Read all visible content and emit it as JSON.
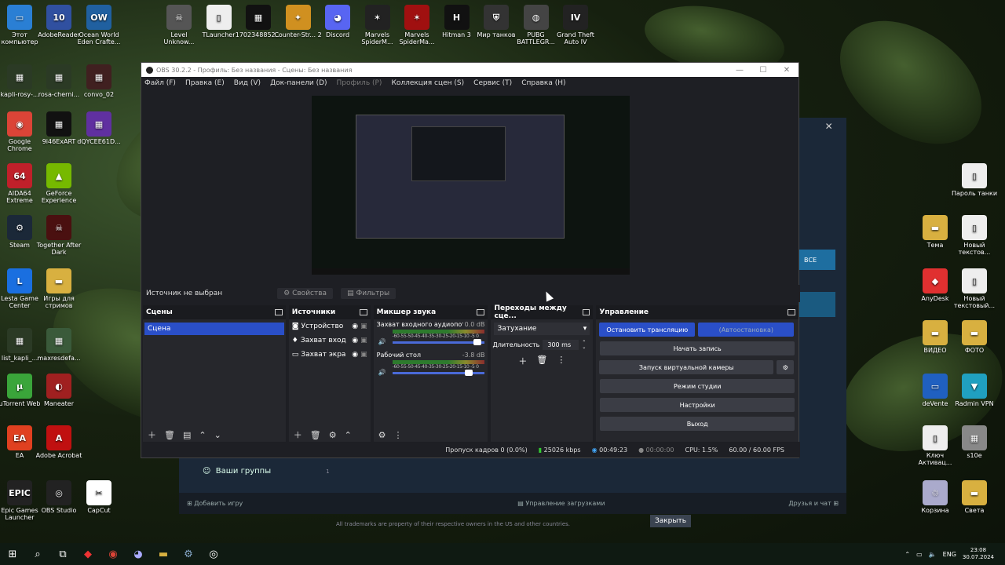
{
  "desktop": {
    "left_icons": [
      {
        "label": "Этот компьютер",
        "color": "#2a7fd4",
        "glyph": "▭"
      },
      {
        "label": "kapli-rosy-...",
        "color": "#2b3a25",
        "glyph": "▦"
      },
      {
        "label": "Google Chrome",
        "color": "#db4437",
        "glyph": "◉"
      },
      {
        "label": "AIDA64 Extreme",
        "color": "#c0202a",
        "glyph": "64"
      },
      {
        "label": "Steam",
        "color": "#1b2838",
        "glyph": "⚙"
      },
      {
        "label": "Lesta Game Center",
        "color": "#1a6fe0",
        "glyph": "L"
      },
      {
        "label": "list_kapli_...",
        "color": "#2b3a25",
        "glyph": "▦"
      },
      {
        "label": "uTorrent Web",
        "color": "#3aa53a",
        "glyph": "µ"
      },
      {
        "label": "EA",
        "color": "#e04020",
        "glyph": "EA"
      },
      {
        "label": "Epic Games Launcher",
        "color": "#222",
        "glyph": "EPIC"
      }
    ],
    "col2_icons": [
      {
        "label": "AdobeReader",
        "color": "#3050a0",
        "glyph": "10"
      },
      {
        "label": "rosa-cherni...",
        "color": "#2b3a25",
        "glyph": "▦"
      },
      {
        "label": "9i46ExART",
        "color": "#111",
        "glyph": "▦"
      },
      {
        "label": "GeForce Experience",
        "color": "#76b900",
        "glyph": "▲"
      },
      {
        "label": "Together After Dark",
        "color": "#4a1010",
        "glyph": "☠"
      },
      {
        "label": "Игры для стримов",
        "color": "#d8b040",
        "glyph": "▬"
      },
      {
        "label": "maxresdefa...",
        "color": "#3a5a3a",
        "glyph": "▦"
      },
      {
        "label": "Maneater",
        "color": "#a02020",
        "glyph": "◐"
      },
      {
        "label": "Adobe Acrobat",
        "color": "#c01010",
        "glyph": "A"
      },
      {
        "label": "OBS Studio",
        "color": "#222",
        "glyph": "◎"
      }
    ],
    "col3_icons": [
      {
        "label": "Ocean World Eden Crafte...",
        "color": "#2060a0",
        "glyph": "OW"
      },
      {
        "label": "convo_02",
        "color": "#402020",
        "glyph": "▦"
      },
      {
        "label": "dQYCEE61D...",
        "color": "#6030a0",
        "glyph": "▦"
      },
      {
        "label": "CapCut",
        "color": "#fff",
        "glyph": "✂"
      }
    ],
    "top_icons": [
      {
        "label": "Level Unknow...",
        "color": "#555",
        "glyph": "☠"
      },
      {
        "label": "TLauncher",
        "color": "#eee",
        "glyph": "▯"
      },
      {
        "label": "1702348852...",
        "color": "#111",
        "glyph": "▦"
      },
      {
        "label": "Counter-Str... 2",
        "color": "#d09020",
        "glyph": "✦"
      },
      {
        "label": "Discord",
        "color": "#5865f2",
        "glyph": "◕"
      },
      {
        "label": "Marvels SpiderM...",
        "color": "#222",
        "glyph": "✶"
      },
      {
        "label": "Marvels SpiderMa...",
        "color": "#a01010",
        "glyph": "✶"
      },
      {
        "label": "Hitman 3",
        "color": "#111",
        "glyph": "H"
      },
      {
        "label": "Мир танков",
        "color": "#333",
        "glyph": "⛨"
      },
      {
        "label": "PUBG BATTLEGR...",
        "color": "#444",
        "glyph": "◍"
      },
      {
        "label": "Grand Theft Auto IV",
        "color": "#222",
        "glyph": "IV"
      }
    ],
    "right_icons": [
      {
        "label": "Пароль танки",
        "color": "#eee",
        "glyph": "▯"
      },
      {
        "label": "Тема",
        "color": "#d8b040",
        "glyph": "▬"
      },
      {
        "label": "Новый текстов...",
        "color": "#eee",
        "glyph": "▯"
      },
      {
        "label": "AnyDesk",
        "color": "#e03030",
        "glyph": "◆"
      },
      {
        "label": "Новый текстовый...",
        "color": "#eee",
        "glyph": "▯"
      },
      {
        "label": "ВИДЕО",
        "color": "#d8b040",
        "glyph": "▬"
      },
      {
        "label": "ФОТО",
        "color": "#d8b040",
        "glyph": "▬"
      },
      {
        "label": "deVente",
        "color": "#2060c0",
        "glyph": "▭"
      },
      {
        "label": "Radmin VPN",
        "color": "#20a0c0",
        "glyph": "▼"
      },
      {
        "label": "Ключ Активац...",
        "color": "#eee",
        "glyph": "▯"
      },
      {
        "label": "s10e",
        "color": "#888",
        "glyph": "▦"
      },
      {
        "label": "Корзина",
        "color": "#aac",
        "glyph": "♲"
      },
      {
        "label": "Света",
        "color": "#d8b040",
        "glyph": "▬"
      }
    ]
  },
  "steam": {
    "btn_all": "ВСЕ",
    "groups_label": "Ваши группы",
    "add_game": "Добавить игру",
    "downloads": "Управление загрузками",
    "friends": "Друзья и чат",
    "legal": "All trademarks are property of their respective owners in the US and other countries.",
    "close": "Закрыть",
    "count": "1"
  },
  "obs": {
    "title": "OBS 30.2.2 - Профиль: Без названия - Сцены: Без названия",
    "menu": [
      "Файл (F)",
      "Правка (E)",
      "Вид (V)",
      "Док-панели (D)",
      "Профиль (P)",
      "Коллекция сцен (S)",
      "Сервис (T)",
      "Справка (H)"
    ],
    "source_bar": {
      "no_source": "Источник не выбран",
      "properties": "Свойства",
      "filters": "Фильтры"
    },
    "scenes": {
      "title": "Сцены",
      "items": [
        "Сцена"
      ]
    },
    "sources": {
      "title": "Источники",
      "items": [
        "Устройство",
        "Захват вход",
        "Захват экра"
      ]
    },
    "mixer": {
      "title": "Микшер звука",
      "scale": "-60-55-50-45-40-35-30-25-20-15-10 -5 0",
      "channels": [
        {
          "name": "Захват входного аудиопото",
          "db": "0.0 dB",
          "level": 0.88
        },
        {
          "name": "Рабочий стол",
          "db": "-3.8 dB",
          "level": 0.78
        }
      ]
    },
    "transitions": {
      "title": "Переходы между сце...",
      "type": "Затухание",
      "duration_label": "Длительность",
      "duration": "300 ms"
    },
    "controls": {
      "title": "Управление",
      "stop_stream": "Остановить трансляцию",
      "autostop": "(Автоостановка)",
      "start_record": "Начать запись",
      "virtual_cam": "Запуск виртуальной камеры",
      "studio_mode": "Режим студии",
      "settings": "Настройки",
      "exit": "Выход"
    },
    "status": {
      "dropped": "Пропуск кадров 0 (0.0%)",
      "bitrate": "25026 kbps",
      "stream_time": "00:49:23",
      "rec_time": "00:00:00",
      "cpu": "CPU: 1.5%",
      "fps": "60.00 / 60.00 FPS"
    }
  },
  "taskbar": {
    "lang": "ENG",
    "time": "23:08",
    "date": "30.07.2024"
  }
}
